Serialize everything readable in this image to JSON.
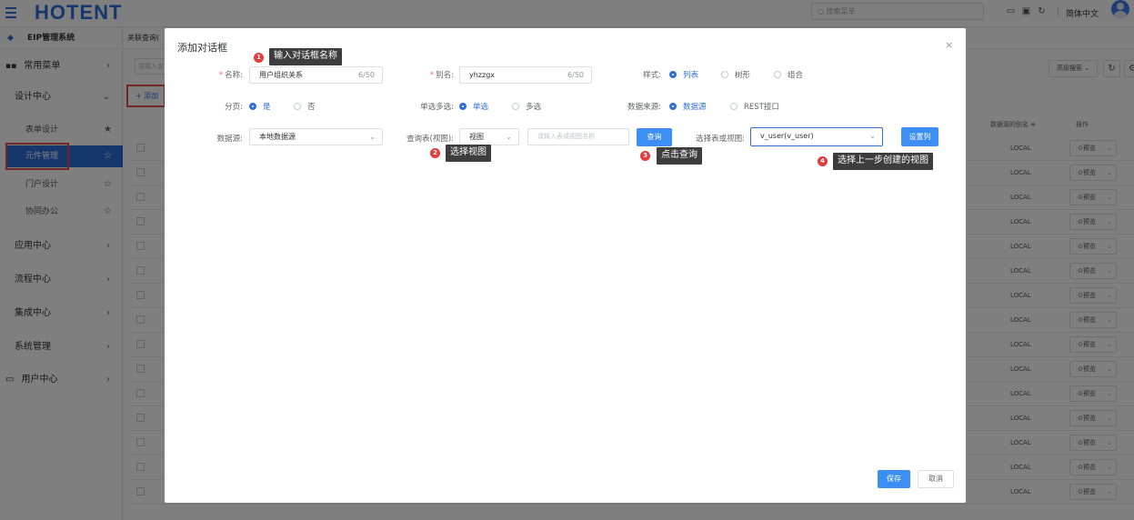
{
  "topbar": {
    "logo": "HOTENT",
    "search_placeholder": "搜索菜单",
    "language": "简体中文"
  },
  "sidebar": {
    "system": "EIP管理系统",
    "items": [
      {
        "label": "常用菜单"
      },
      {
        "label": "设计中心"
      },
      {
        "label": "应用中心"
      },
      {
        "label": "流程中心"
      },
      {
        "label": "集成中心"
      },
      {
        "label": "系统管理"
      },
      {
        "label": "用户中心"
      }
    ],
    "sub_items": [
      {
        "label": "表单设计"
      },
      {
        "label": "元件管理"
      },
      {
        "label": "门户设计"
      },
      {
        "label": "协同办公"
      }
    ]
  },
  "background": {
    "tab": "关联查询(",
    "search_placeholder": "请输入名",
    "add_label": "+ 添加",
    "advanced_search": "高级搜索 ⌄",
    "col_datasource_alias": "数据源的别名 ≑",
    "col_action": "操作",
    "row_local": "LOCAL",
    "row_preview": "预览"
  },
  "dialog": {
    "title": "添加对话框",
    "name_label": "名称:",
    "name_value": "用户组织关系",
    "name_count": "6/50",
    "alias_label": "别名:",
    "alias_value": "yhzzgx",
    "alias_count": "6/50",
    "style_label": "样式:",
    "style_options": [
      "列表",
      "树形",
      "组合"
    ],
    "page_label": "分页:",
    "page_options": [
      "是",
      "否"
    ],
    "select_label": "单选多选:",
    "select_options": [
      "单选",
      "多选"
    ],
    "source_type_label": "数据来源:",
    "source_type_options": [
      "数据源",
      "REST接口"
    ],
    "datasource_label": "数据源:",
    "datasource_value": "本地数据源",
    "query_table_label": "查询表(视图):",
    "query_table_value": "视图",
    "query_name_placeholder": "请输入表或视图名称",
    "query_button": "查询",
    "select_view_label": "选择表或视图:",
    "select_view_value": "v_user(v_user)",
    "set_columns_button": "设置列",
    "save_button": "保存",
    "cancel_button": "取消"
  },
  "annotations": [
    {
      "num": "1",
      "text": "输入对话框名称"
    },
    {
      "num": "2",
      "text": "选择视图"
    },
    {
      "num": "3",
      "text": "点击查询"
    },
    {
      "num": "4",
      "text": "选择上一步创建的视图"
    }
  ]
}
